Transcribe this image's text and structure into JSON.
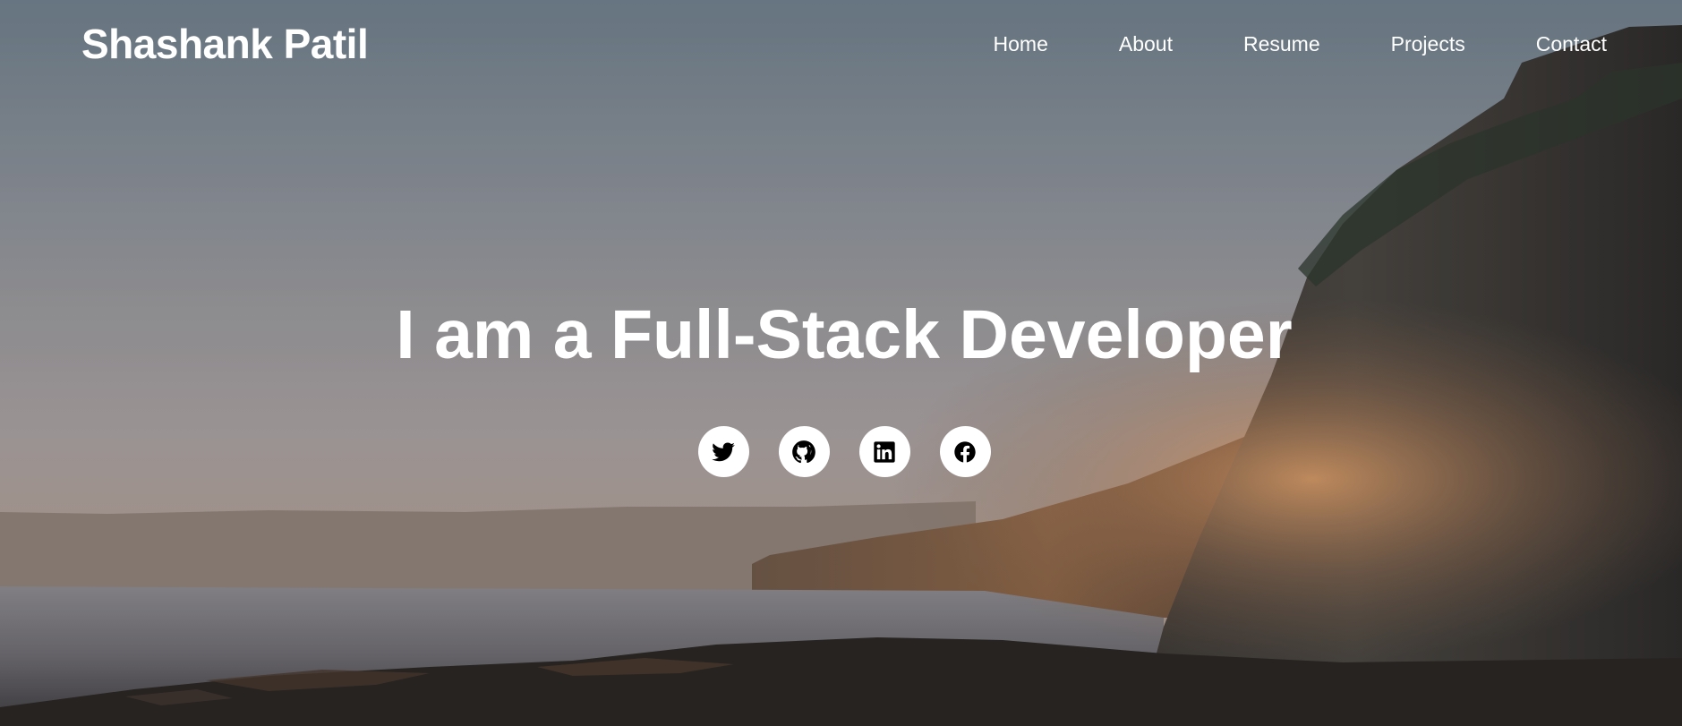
{
  "header": {
    "brand": "Shashank Patil",
    "nav": [
      {
        "label": "Home"
      },
      {
        "label": "About"
      },
      {
        "label": "Resume"
      },
      {
        "label": "Projects"
      },
      {
        "label": "Contact"
      }
    ]
  },
  "hero": {
    "headline": "I am a Full-Stack Developer",
    "socials": [
      {
        "icon": "twitter-icon"
      },
      {
        "icon": "github-icon"
      },
      {
        "icon": "linkedin-icon"
      },
      {
        "icon": "facebook-icon"
      }
    ]
  },
  "colors": {
    "text": "#ffffff",
    "icon_bg": "#ffffff",
    "icon_fg": "#000000"
  }
}
